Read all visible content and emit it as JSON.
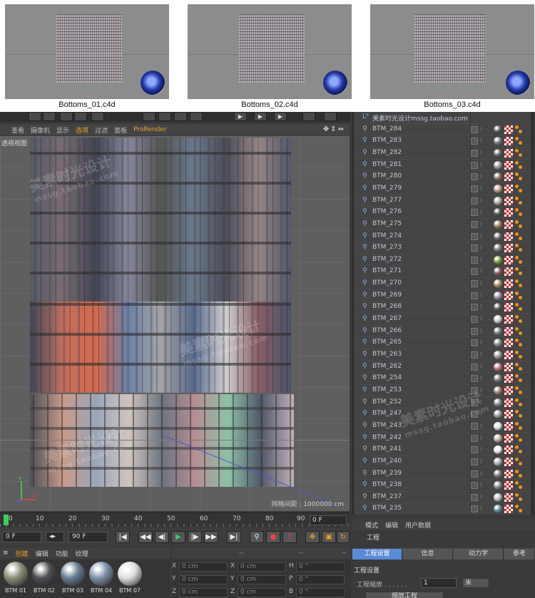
{
  "thumbnails": [
    {
      "caption": "Bottoms_01.c4d"
    },
    {
      "caption": "Bottoms_02.c4d"
    },
    {
      "caption": "Bottoms_03.c4d"
    }
  ],
  "viewport": {
    "menu": [
      "查看",
      "摄像机",
      "显示",
      "选项",
      "过滤",
      "面板",
      "ProRender"
    ],
    "active_menu": "选项",
    "nav_icons": "✥⇕⇔",
    "label": "透视视图",
    "grid_distance": "网格间距 : 1000000 cm"
  },
  "timeline": {
    "marks": [
      "0",
      "10",
      "20",
      "30",
      "40",
      "50",
      "60",
      "70",
      "80",
      "90"
    ],
    "end_field": "0 F"
  },
  "transport": {
    "current_frame": "0 F",
    "end_frame": "90 F",
    "buttons": [
      "|◀",
      "◀◀",
      "◀|",
      "▶",
      "|▶",
      "▶▶",
      "▶|",
      "⚲",
      "●",
      "?"
    ]
  },
  "materials": {
    "tabs": [
      "创建",
      "编辑",
      "功能",
      "纹理"
    ],
    "active_tab": "创建",
    "items": [
      {
        "label": "BTM 01",
        "color": "#8a9078"
      },
      {
        "label": "BTM 02",
        "color": "#505054"
      },
      {
        "label": "BTM 03",
        "color": "#6a7c92"
      },
      {
        "label": "BTM 04",
        "color": "#7e90a8"
      },
      {
        "label": "BTM 07",
        "color": "#e0e0e0"
      }
    ]
  },
  "coordinates": {
    "header": [
      "--",
      "--",
      "--"
    ],
    "rows": [
      {
        "a": "X",
        "av": "0 cm",
        "b": "X",
        "bv": "0 cm",
        "c": "H",
        "cv": "0 °"
      },
      {
        "a": "Y",
        "av": "0 cm",
        "b": "Y",
        "bv": "0 cm",
        "c": "P",
        "cv": "0 °"
      },
      {
        "a": "Z",
        "av": "0 cm",
        "b": "Z",
        "bv": "0 cm",
        "c": "B",
        "cv": "0 °"
      }
    ]
  },
  "object_manager": {
    "header": "美素时光设计mssg.taobao.com",
    "objects": [
      {
        "name": "BTM_284",
        "color": "#555"
      },
      {
        "name": "BTM_283",
        "color": "#777"
      },
      {
        "name": "BTM_282",
        "color": "#666"
      },
      {
        "name": "BTM_281",
        "color": "#999"
      },
      {
        "name": "BTM_280",
        "color": "#8a6a5a"
      },
      {
        "name": "BTM_279",
        "color": "#bb9988"
      },
      {
        "name": "BTM_277",
        "color": "#b0b0a8"
      },
      {
        "name": "BTM_276",
        "color": "#555"
      },
      {
        "name": "BTM_275",
        "color": "#a07a60"
      },
      {
        "name": "BTM_274",
        "color": "#666"
      },
      {
        "name": "BTM_273",
        "color": "#777"
      },
      {
        "name": "BTM_272",
        "color": "#7a9a3a"
      },
      {
        "name": "BTM_271",
        "color": "#8a5a5a"
      },
      {
        "name": "BTM_270",
        "color": "#aa8866"
      },
      {
        "name": "BTM_269",
        "color": "#a08aa0"
      },
      {
        "name": "BTM_268",
        "color": "#555"
      },
      {
        "name": "BTM_267",
        "color": "#ccc"
      },
      {
        "name": "BTM_266",
        "color": "#777"
      },
      {
        "name": "BTM_265",
        "color": "#888"
      },
      {
        "name": "BTM_263",
        "color": "#999"
      },
      {
        "name": "BTM_262",
        "color": "#c07080"
      },
      {
        "name": "BTM_254",
        "color": "#777"
      },
      {
        "name": "BTM_253",
        "color": "#a08070"
      },
      {
        "name": "BTM_252",
        "color": "#888"
      },
      {
        "name": "BTM_247",
        "color": "#9a9a9a"
      },
      {
        "name": "BTM_243",
        "color": "#ddd"
      },
      {
        "name": "BTM_242",
        "color": "#c8a898"
      },
      {
        "name": "BTM_241",
        "color": "#eee"
      },
      {
        "name": "BTM_240",
        "color": "#aaa"
      },
      {
        "name": "BTM_239",
        "color": "#777"
      },
      {
        "name": "BTM_238",
        "color": "#888"
      },
      {
        "name": "BTM_237",
        "color": "#bbb"
      },
      {
        "name": "BTM_235",
        "color": "#5a8a9a"
      }
    ]
  },
  "attributes": {
    "menu": [
      "模式",
      "编辑",
      "用户数据"
    ],
    "title": "工程",
    "tabs": [
      "工程设置",
      "信息",
      "动力学",
      "参考"
    ],
    "active_tab": "工程设置",
    "section": "工程设置",
    "scale_label": "工程缩放 . . . . . .",
    "scale_value": "1",
    "scale_unit": "米",
    "button": "缩放工程"
  }
}
